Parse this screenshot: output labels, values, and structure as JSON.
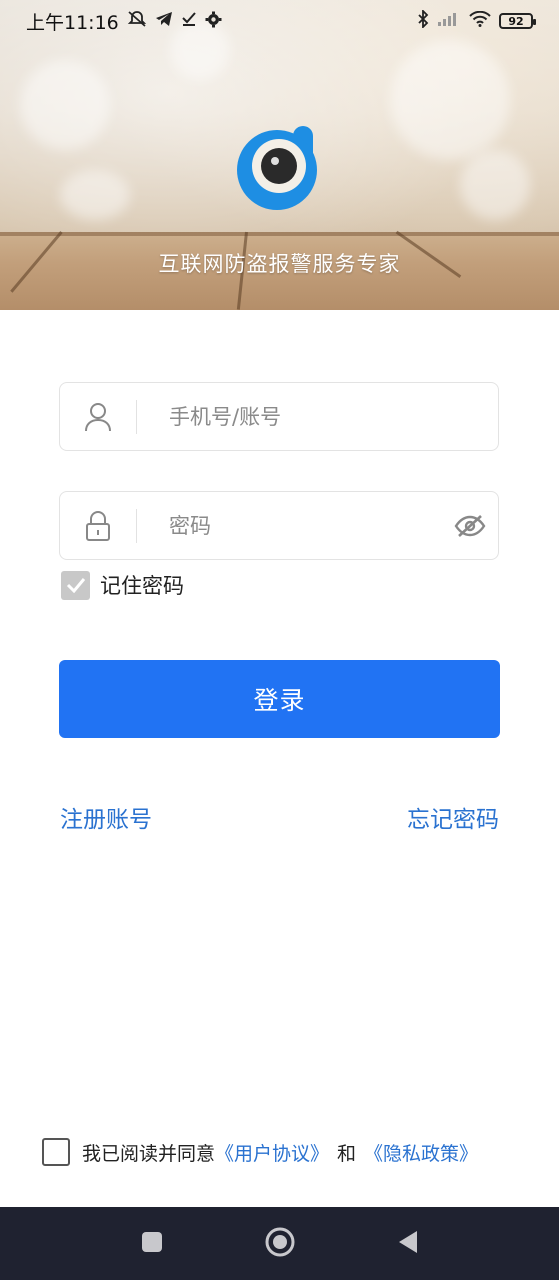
{
  "status_bar": {
    "time": "上午11:16",
    "battery": "92",
    "icons": [
      "bell-muted-icon",
      "telegram-icon",
      "checkmark-icon",
      "gear-icon",
      "bluetooth-icon",
      "signal-icon",
      "wifi-icon",
      "battery-icon"
    ]
  },
  "header": {
    "slogan": "互联网防盗报警服务专家",
    "logo": "app-logo"
  },
  "login": {
    "account_placeholder": "手机号/账号",
    "password_placeholder": "密码",
    "remember_label": "记住密码",
    "remember_checked": true,
    "login_button": "登录",
    "register_link": "注册账号",
    "forgot_link": "忘记密码"
  },
  "agreement": {
    "prefix": "我已阅读并同意",
    "user_agreement": "《用户协议》",
    "and": "和",
    "privacy_policy": "《隐私政策》",
    "checked": false
  },
  "colors": {
    "primary": "#2173f3",
    "link": "#2a72d0",
    "logo_blue": "#1e8ee3",
    "navbar": "#1f2230"
  }
}
